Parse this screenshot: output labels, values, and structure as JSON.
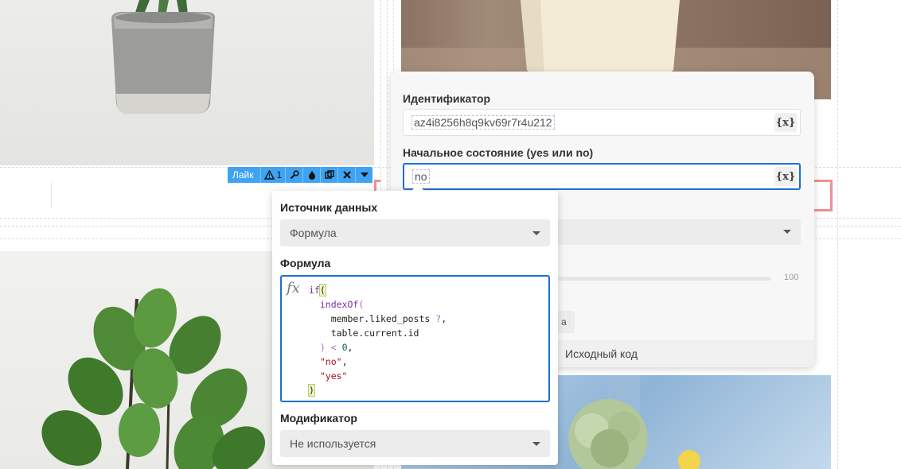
{
  "toolbar": {
    "label": "Лайк",
    "warning_count": "1",
    "icons": [
      "warning-icon",
      "wrench-icon",
      "drop-icon",
      "copy-icon",
      "close-icon",
      "chevron-down-icon"
    ]
  },
  "right_panel": {
    "id_label": "Идентификатор",
    "id_value": "az4i8256h8q9kv69r7r4u212",
    "state_label": "Начальное состояние (yes или no)",
    "state_value": "no",
    "variable_button": "{x}",
    "slider_max": "100",
    "partial_button": "а",
    "source_code_link": "Исходный код"
  },
  "left_panel": {
    "source_label": "Источник данных",
    "source_value": "Формула",
    "formula_label": "Формула",
    "formula_lines": [
      {
        "parts": [
          {
            "t": "if",
            "c": "kw"
          },
          {
            "t": "(",
            "c": "brk"
          }
        ]
      },
      {
        "parts": [
          {
            "t": "  "
          },
          {
            "t": "indexOf",
            "c": "kw"
          },
          {
            "t": "(",
            "c": "op"
          }
        ]
      },
      {
        "parts": [
          {
            "t": "    member.liked_posts "
          },
          {
            "t": "?",
            "c": "op"
          },
          {
            "t": ","
          }
        ]
      },
      {
        "parts": [
          {
            "t": "    table.current.id"
          }
        ]
      },
      {
        "parts": [
          {
            "t": "  "
          },
          {
            "t": ")",
            "c": "op"
          },
          {
            "t": " "
          },
          {
            "t": "<",
            "c": "op"
          },
          {
            "t": " "
          },
          {
            "t": "0",
            "c": "num"
          },
          {
            "t": ","
          }
        ]
      },
      {
        "parts": [
          {
            "t": "  "
          },
          {
            "t": "\"no\"",
            "c": "str"
          },
          {
            "t": ","
          }
        ]
      },
      {
        "parts": [
          {
            "t": "  "
          },
          {
            "t": "\"yes\"",
            "c": "str"
          }
        ]
      },
      {
        "parts": [
          {
            "t": ")",
            "c": "brk"
          }
        ]
      }
    ],
    "modifier_label": "Модификатор",
    "modifier_value": "Не используется"
  },
  "colors": {
    "accent": "#1e6fd0",
    "toolbar": "#3fa3f2",
    "highlight": "#ef8f95"
  }
}
